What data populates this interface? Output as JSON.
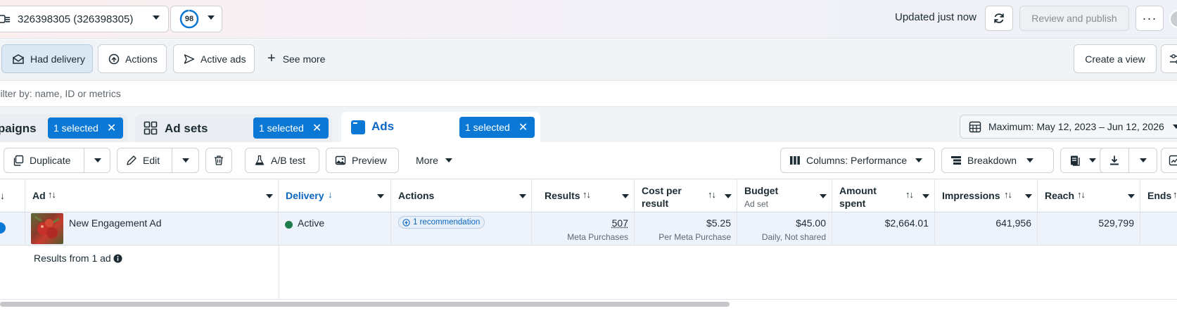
{
  "header": {
    "account_label": "326398305 (326398305)",
    "score": "98",
    "updated_text": "Updated just now",
    "publish_label": "Review and publish",
    "more_label": "···"
  },
  "filters": {
    "chips": [
      "Had delivery",
      "Actions",
      "Active ads"
    ],
    "see_more": "See more",
    "create_view": "Create a view"
  },
  "search": {
    "placeholder": "Filter by: name, ID or metrics"
  },
  "levels": {
    "campaigns_label": "Campaigns",
    "adsets_label": "Ad sets",
    "ads_label": "Ads",
    "selected_label": "1 selected",
    "date_range": "Maximum: May 12, 2023 – Jun 12, 2026"
  },
  "toolbar": {
    "duplicate": "Duplicate",
    "edit": "Edit",
    "ab_test": "A/B test",
    "preview": "Preview",
    "more": "More",
    "columns": "Columns: Performance",
    "breakdown": "Breakdown"
  },
  "table": {
    "headers": {
      "ad": "Ad",
      "delivery": "Delivery",
      "actions": "Actions",
      "results": "Results",
      "cost_per_result_1": "Cost per",
      "cost_per_result_2": "result",
      "budget": "Budget",
      "budget_sub": "Ad set",
      "amount_spent_1": "Amount",
      "amount_spent_2": "spent",
      "impressions": "Impressions",
      "reach": "Reach",
      "ends": "Ends"
    },
    "sort_glyph": "↑↓",
    "delivery_sort_glyph": "↓",
    "rows": [
      {
        "ad_name": "New Engagement Ad",
        "delivery": "Active",
        "actions": "1 recommendation",
        "results": "507",
        "results_sub": "Meta Purchases",
        "cost": "$5.25",
        "cost_sub": "Per Meta Purchase",
        "budget": "$45.00",
        "budget_sub": "Daily, Not shared",
        "amount_spent": "$2,664.01",
        "impressions": "641,956",
        "reach": "529,799"
      }
    ],
    "footer": "Results from 1 ad"
  },
  "colors": {
    "accent": "#0a78d4",
    "active_dot": "#1e7d4a",
    "selected_row": "#eef3fb"
  }
}
